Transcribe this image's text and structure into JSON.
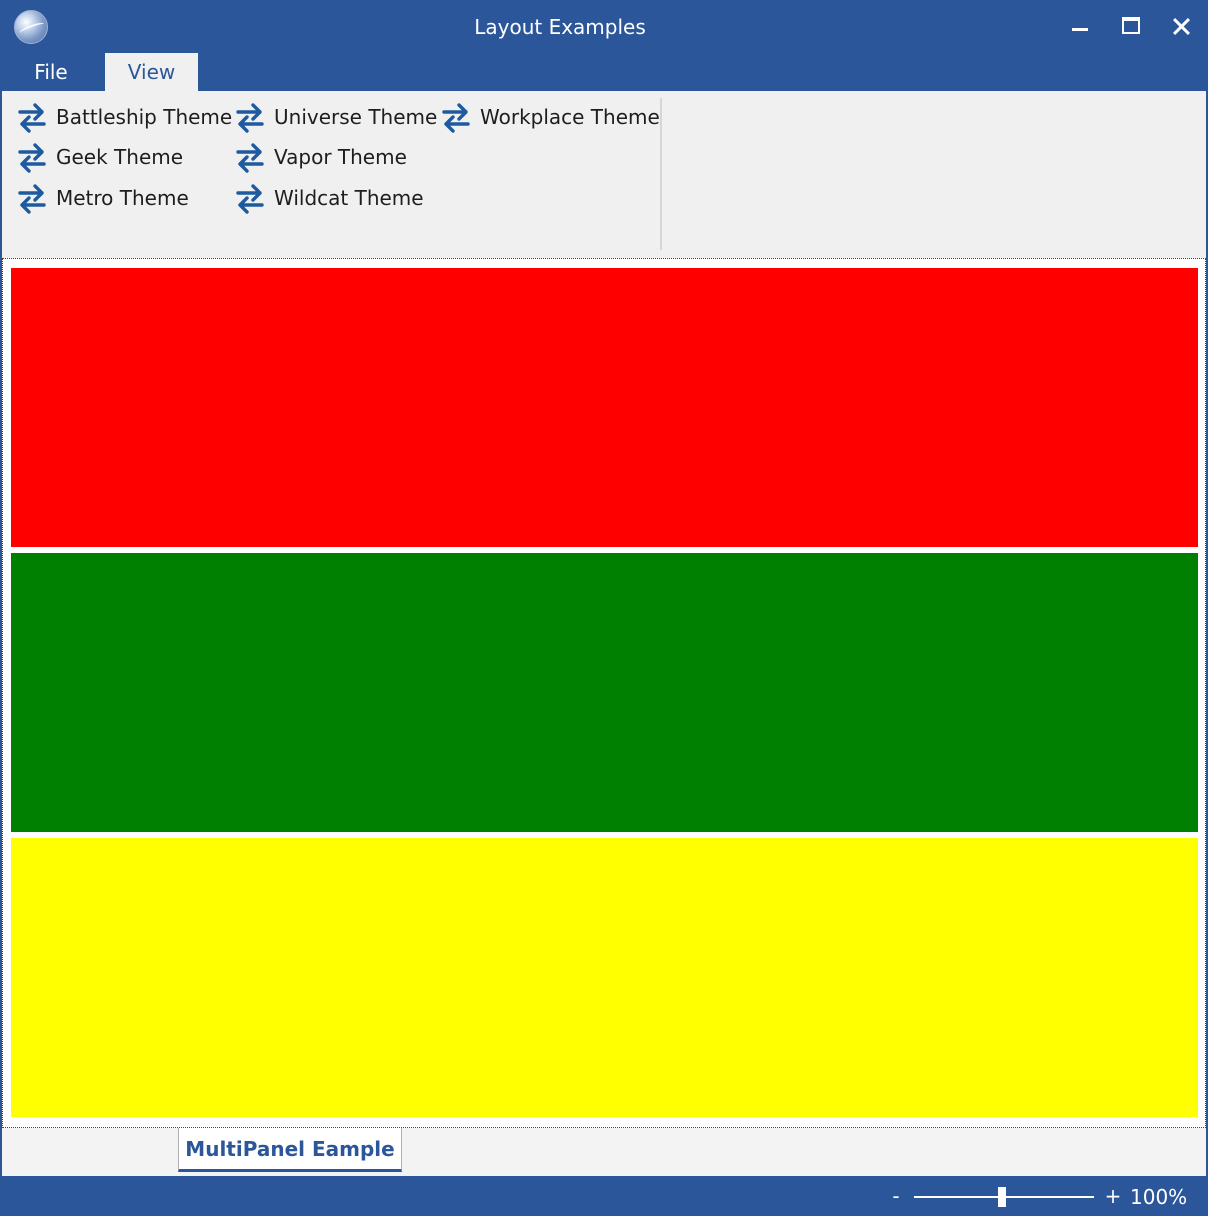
{
  "window": {
    "title": "Layout Examples",
    "icon": "globe-icon"
  },
  "menu": {
    "tabs": [
      {
        "label": "File",
        "selected": false
      },
      {
        "label": "View",
        "selected": true
      }
    ]
  },
  "ribbon": {
    "items": [
      {
        "label": "Battleship Theme",
        "icon": "swap-arrows-icon"
      },
      {
        "label": "Geek Theme",
        "icon": "swap-arrows-icon"
      },
      {
        "label": "Metro Theme",
        "icon": "swap-arrows-icon"
      },
      {
        "label": "Universe Theme",
        "icon": "swap-arrows-icon"
      },
      {
        "label": "Vapor Theme",
        "icon": "swap-arrows-icon"
      },
      {
        "label": "Wildcat Theme",
        "icon": "swap-arrows-icon"
      },
      {
        "label": "Workplace Theme",
        "icon": "swap-arrows-icon"
      }
    ]
  },
  "panels": [
    {
      "color": "#ff0000"
    },
    {
      "color": "#008000"
    },
    {
      "color": "#ffff00"
    }
  ],
  "bottom_tabs": [
    {
      "label": "MultiPanel Eample",
      "selected": true
    }
  ],
  "status": {
    "zoom_minus": "-",
    "zoom_plus": "+",
    "zoom_value": "100%",
    "zoom_level": 0.47
  },
  "colors": {
    "accent": "#2b579a",
    "icon_blue": "#1d5aa0"
  }
}
